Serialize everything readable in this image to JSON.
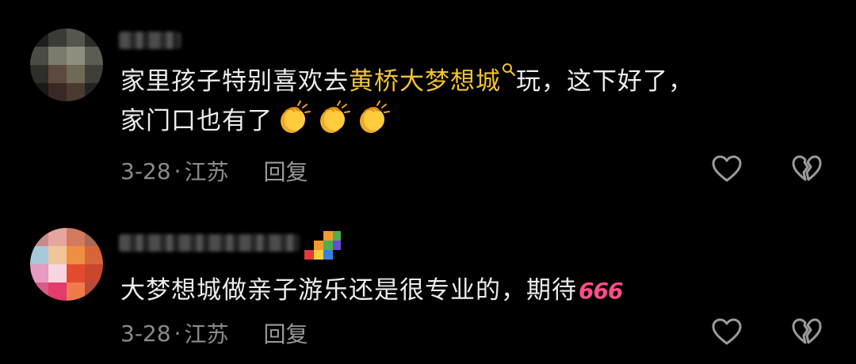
{
  "comments": [
    {
      "content_before": "家里孩子特别喜欢去",
      "link_text": "黄桥大梦想城",
      "content_line1_after": "玩，这下好了，",
      "content_line2": "家门口也有了",
      "emojis": [
        "clapping-hands",
        "clapping-hands",
        "clapping-hands"
      ],
      "date": "3-28",
      "separator": "·",
      "location": "江苏",
      "reply_label": "回复"
    },
    {
      "content": "大梦想城做亲子游乐还是很专业的，期待",
      "emoji_text": "666",
      "date": "3-28",
      "separator": "·",
      "location": "江苏",
      "reply_label": "回复"
    }
  ],
  "colors": {
    "background": "#000000",
    "text": "#ececec",
    "link": "#f1c232",
    "meta": "#8a8a8a",
    "emoji_666": "#ff4d8d"
  }
}
